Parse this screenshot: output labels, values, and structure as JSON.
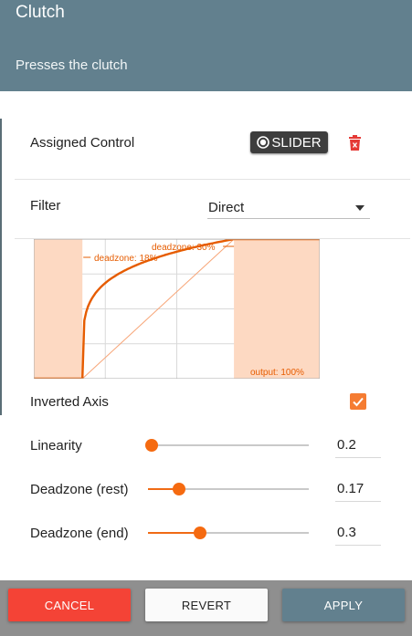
{
  "header": {
    "title": "Clutch",
    "subtitle": "Presses the clutch"
  },
  "assigned_control": {
    "label": "Assigned Control",
    "chip_label": "SLIDER",
    "chip_icon": "record-icon",
    "delete_icon": "trash-icon"
  },
  "filter": {
    "label": "Filter",
    "value": "Direct"
  },
  "graph": {
    "deadzone_start_label": "deadzone: 18%",
    "deadzone_end_label": "deadzone: 30%",
    "output_label": "output: 100%",
    "deadzone_rest": 0.17,
    "deadzone_end": 0.3,
    "linearity": 0.2,
    "output": 1.0,
    "colors": {
      "zone_fill": "#fdd9c2",
      "curve": "#e65c00",
      "grid": "#d9d9d9",
      "label": "#e65c00"
    }
  },
  "inverted_axis": {
    "label": "Inverted Axis",
    "checked": true
  },
  "settings": {
    "linearity": {
      "label": "Linearity",
      "value": "0.2",
      "fraction": 0.0
    },
    "deadzone_rest": {
      "label": "Deadzone (rest)",
      "value": "0.17",
      "fraction": 0.17
    },
    "deadzone_end": {
      "label": "Deadzone (end)",
      "value": "0.3",
      "fraction": 0.3
    }
  },
  "buttons": {
    "cancel": "CANCEL",
    "revert": "REVERT",
    "apply": "APPLY"
  },
  "colors": {
    "header": "#62808e",
    "accent": "#f56a10",
    "cancel": "#f44336",
    "apply": "#62808e"
  }
}
